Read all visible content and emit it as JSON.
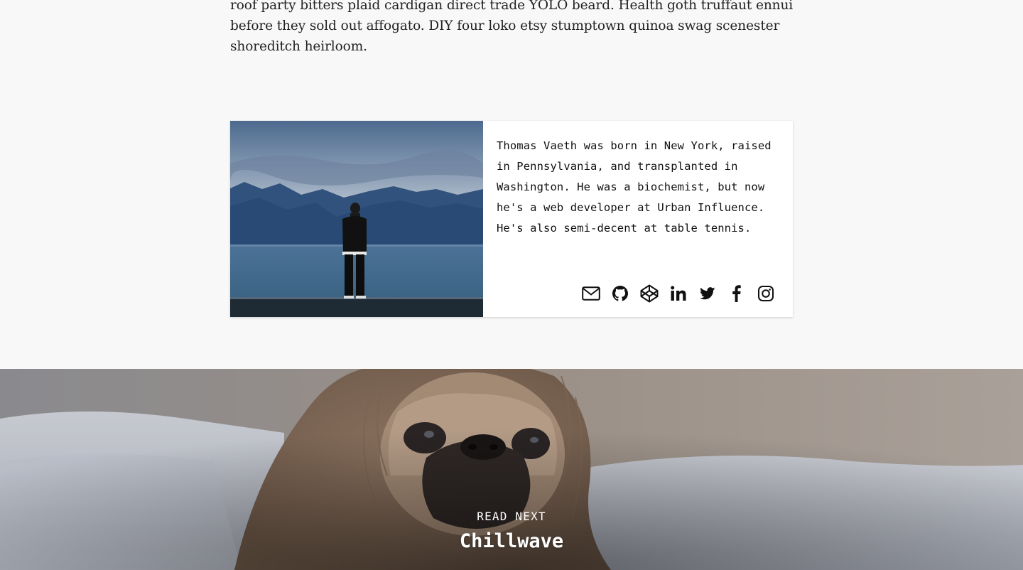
{
  "article": {
    "tail_text": "roof party bitters plaid cardigan direct trade YOLO beard. Health goth truffaut ennui before they sold out affogato. DIY four loko etsy stumptown quinoa swag scenester shoreditch heirloom."
  },
  "author": {
    "bio": "Thomas Vaeth was born in New York, raised in Pennsylvania, and transplanted in Washington. He was a biochemist, but now he's a web developer at Urban Influence. He's also semi-decent at table tennis.",
    "photo_alt": "Man standing at the edge of a lake facing mountains",
    "social": [
      {
        "name": "email",
        "icon": "envelope-icon"
      },
      {
        "name": "github",
        "icon": "github-icon"
      },
      {
        "name": "codepen",
        "icon": "codepen-icon"
      },
      {
        "name": "linkedin",
        "icon": "linkedin-icon"
      },
      {
        "name": "twitter",
        "icon": "twitter-icon"
      },
      {
        "name": "facebook",
        "icon": "facebook-icon"
      },
      {
        "name": "instagram",
        "icon": "instagram-icon"
      }
    ]
  },
  "read_next": {
    "kicker": "READ NEXT",
    "title": "Chillwave",
    "image_alt": "Pug wrapped in a blanket"
  },
  "colors": {
    "page_background": "#f7f8f7",
    "text": "#222222",
    "card_background": "#ffffff"
  }
}
